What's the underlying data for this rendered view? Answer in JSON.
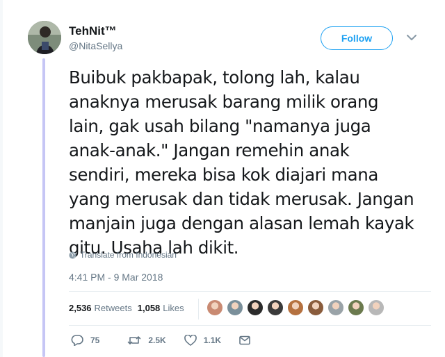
{
  "user": {
    "display_name": "TehNit™",
    "handle": "@NitaSellya"
  },
  "follow_label": "Follow",
  "tweet": {
    "lines": [
      "Buibuk pakbapak, tolong lah, kalau",
      "anaknya merusak barang milik orang",
      "lain, gak usah bilang \"namanya juga",
      "anak-anak.\" Jangan remehin anak",
      "sendiri, mereka bisa kok diajari mana",
      "yang merusak dan tidak merusak. Jangan",
      "manjain juga dengan alasan lemah kayak",
      "gitu. Usaha lah dikit."
    ],
    "translate_label": "Translate from Indonesian",
    "timestamp": "4:41 PM - 9 Mar 2018"
  },
  "stats": {
    "retweets_count": "2,536",
    "retweets_label": "Retweets",
    "likes_count": "1,058",
    "likes_label": "Likes"
  },
  "liker_avatars": [
    "#c98a72",
    "#7a8f9a",
    "#2b2b2b",
    "#3a3a3a",
    "#b5713f",
    "#8a5c3c",
    "#9aa3a8",
    "#6b7a4e",
    "#b8b8b8"
  ],
  "actions": {
    "reply_count": "75",
    "retweet_count": "2.5K",
    "like_count": "1.1K"
  },
  "colors": {
    "accent": "#1da1f2",
    "thread_line": "#c6c6f5",
    "muted": "#657786"
  }
}
